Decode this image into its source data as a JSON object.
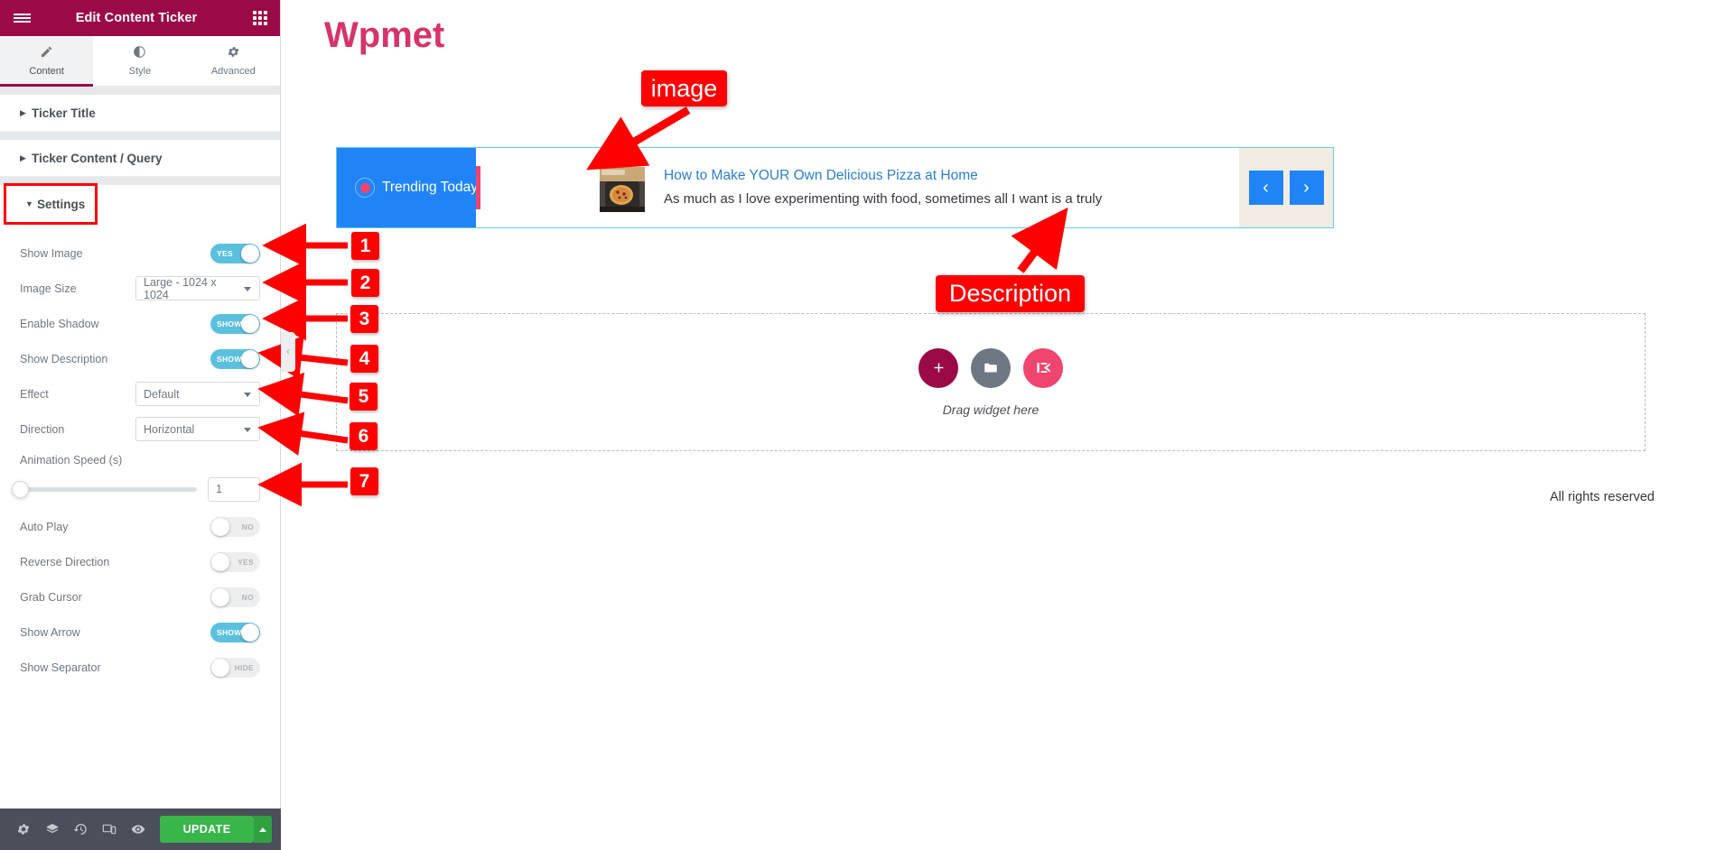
{
  "panel": {
    "header": {
      "title": "Edit Content Ticker",
      "menu_icon": "hamburger-menu-icon",
      "grid_icon": "apps-grid-icon"
    },
    "tabs": [
      {
        "label": "Content",
        "icon": "pencil-icon",
        "active": true
      },
      {
        "label": "Style",
        "icon": "contrast-half-circle-icon",
        "active": false
      },
      {
        "label": "Advanced",
        "icon": "gear-icon",
        "active": false
      }
    ],
    "sections": [
      {
        "label": "Ticker Title",
        "expanded": false
      },
      {
        "label": "Ticker Content / Query",
        "expanded": false
      },
      {
        "label": "Settings",
        "expanded": true,
        "highlighted": true
      }
    ],
    "controls": [
      {
        "label": "Show Image",
        "type": "switch",
        "state": "on",
        "state_text": "YES",
        "step": "1"
      },
      {
        "label": "Image Size",
        "type": "select",
        "value": "Large - 1024 x 1024",
        "step": "2"
      },
      {
        "label": "Enable Shadow",
        "type": "switch",
        "state": "on",
        "state_text": "SHOW",
        "step": "3"
      },
      {
        "label": "Show Description",
        "type": "switch",
        "state": "on",
        "state_text": "SHOW",
        "step": "4"
      },
      {
        "label": "Effect",
        "type": "select",
        "value": "Default",
        "step": "5"
      },
      {
        "label": "Direction",
        "type": "select",
        "value": "Horizontal",
        "step": "6"
      },
      {
        "label": "Animation Speed (s)",
        "type": "slider",
        "value": "1",
        "step": "7"
      },
      {
        "label": "Auto Play",
        "type": "switch",
        "state": "off",
        "state_text": "NO",
        "step": ""
      },
      {
        "label": "Reverse Direction",
        "type": "switch",
        "state": "off",
        "state_text": "YES",
        "step": ""
      },
      {
        "label": "Grab Cursor",
        "type": "switch",
        "state": "off",
        "state_text": "NO",
        "step": ""
      },
      {
        "label": "Show Arrow",
        "type": "switch",
        "state": "on",
        "state_text": "SHOW",
        "step": ""
      },
      {
        "label": "Show Separator",
        "type": "switch",
        "state": "off",
        "state_text": "HIDE",
        "step": ""
      }
    ],
    "footer": {
      "icons": [
        "gear-icon",
        "layers-icon",
        "history-icon",
        "responsive-mode-icon",
        "preview-eye-icon"
      ],
      "update_label": "UPDATE",
      "update_color": "#39b54a"
    },
    "collapse_handle": "‹"
  },
  "canvas": {
    "logo": "Wpmet",
    "ticker": {
      "badge_label": "Trending Today",
      "badge_color": "#2084f7",
      "accent_color": "#f0456e",
      "item_title": "How to Make YOUR Own Delicious Pizza at Home",
      "item_description": "As much as I love experimenting with food, sometimes all I want is a truly",
      "thumbnail": "pizza-thumbnail",
      "prev_arrow": "‹",
      "next_arrow": "›"
    },
    "dropzone": {
      "label": "Drag widget here",
      "buttons": [
        "add-widget-icon",
        "folder-template-icon",
        "elementskit-icon"
      ]
    },
    "footer_text": "All rights reserved"
  },
  "annotations": {
    "image_label": "image",
    "description_label": "Description",
    "steps": [
      "1",
      "2",
      "3",
      "4",
      "5",
      "6",
      "7"
    ],
    "color": "#ff0000"
  }
}
